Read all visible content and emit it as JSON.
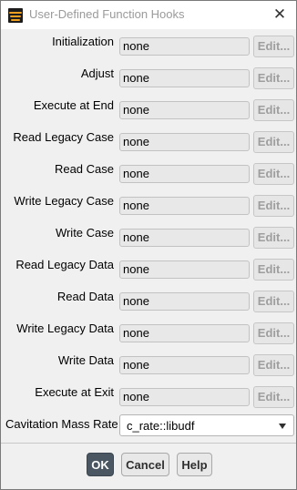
{
  "window": {
    "title": "User-Defined Function Hooks",
    "close_glyph": "✕"
  },
  "hooks": [
    {
      "label": "Initialization",
      "value": "none",
      "edit_label": "Edit..."
    },
    {
      "label": "Adjust",
      "value": "none",
      "edit_label": "Edit..."
    },
    {
      "label": "Execute at End",
      "value": "none",
      "edit_label": "Edit..."
    },
    {
      "label": "Read Legacy Case",
      "value": "none",
      "edit_label": "Edit..."
    },
    {
      "label": "Read Case",
      "value": "none",
      "edit_label": "Edit..."
    },
    {
      "label": "Write Legacy Case",
      "value": "none",
      "edit_label": "Edit..."
    },
    {
      "label": "Write Case",
      "value": "none",
      "edit_label": "Edit..."
    },
    {
      "label": "Read Legacy Data",
      "value": "none",
      "edit_label": "Edit..."
    },
    {
      "label": "Read Data",
      "value": "none",
      "edit_label": "Edit..."
    },
    {
      "label": "Write Legacy Data",
      "value": "none",
      "edit_label": "Edit..."
    },
    {
      "label": "Write Data",
      "value": "none",
      "edit_label": "Edit..."
    },
    {
      "label": "Execute at Exit",
      "value": "none",
      "edit_label": "Edit..."
    }
  ],
  "cavitation": {
    "label": "Cavitation Mass Rate",
    "selected": "c_rate::libudf"
  },
  "buttons": {
    "ok": "OK",
    "cancel": "Cancel",
    "help": "Help"
  },
  "colors": {
    "ok_button": "#4a5762",
    "app_icon_accent": "#f0a020",
    "disabled_field": "#e8e8e8"
  },
  "icons": {
    "app": "fluent-app-icon",
    "close": "close-icon",
    "dropdown": "chevron-down-icon"
  }
}
